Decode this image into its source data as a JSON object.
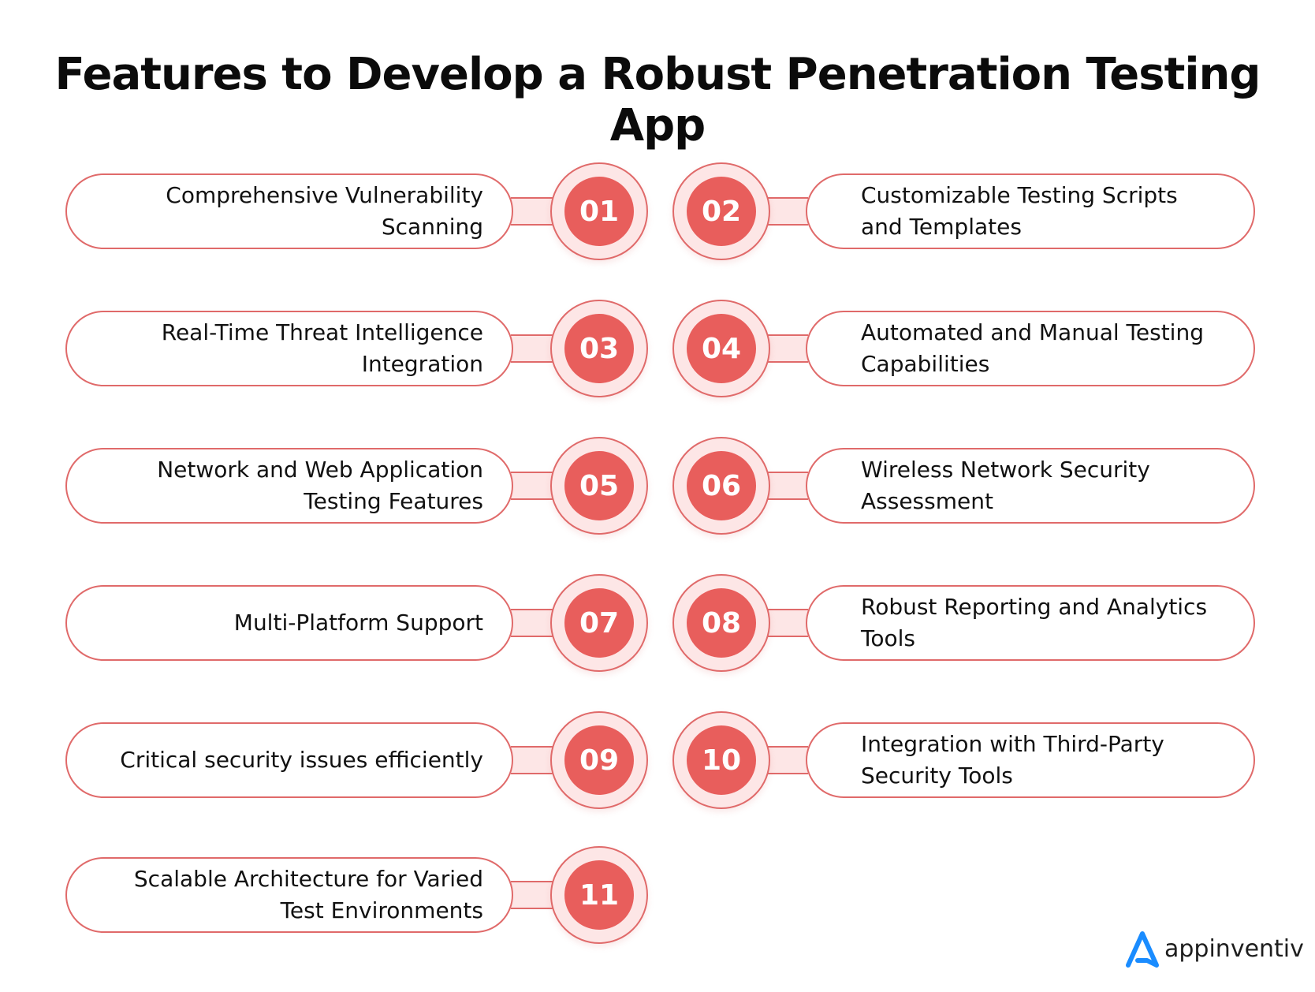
{
  "title": "Features to Develop a Robust Penetration Testing App",
  "colors": {
    "accent": "#e85e5c",
    "accent_light": "#fde6e6",
    "border": "#e06a6a",
    "logo_blue": "#1a8cff"
  },
  "features": [
    {
      "number": "01",
      "label": "Comprehensive Vulnerability\nScanning",
      "side": "left"
    },
    {
      "number": "02",
      "label": "Customizable Testing Scripts\nand Templates",
      "side": "right"
    },
    {
      "number": "03",
      "label": "Real-Time Threat Intelligence\nIntegration",
      "side": "left"
    },
    {
      "number": "04",
      "label": "Automated and Manual Testing\nCapabilities",
      "side": "right"
    },
    {
      "number": "05",
      "label": "Network and Web Application\nTesting Features",
      "side": "left"
    },
    {
      "number": "06",
      "label": "Wireless Network Security\nAssessment",
      "side": "right"
    },
    {
      "number": "07",
      "label": "Multi-Platform Support",
      "side": "left"
    },
    {
      "number": "08",
      "label": "Robust Reporting and Analytics\nTools",
      "side": "right"
    },
    {
      "number": "09",
      "label": "Critical security issues efficiently",
      "side": "left"
    },
    {
      "number": "10",
      "label": "Integration with Third-Party\nSecurity Tools",
      "side": "right"
    },
    {
      "number": "11",
      "label": "Scalable Architecture for Varied\nTest Environments",
      "side": "left"
    }
  ],
  "logo": {
    "icon": "appinventiv-a-icon",
    "text": "appinventiv"
  }
}
